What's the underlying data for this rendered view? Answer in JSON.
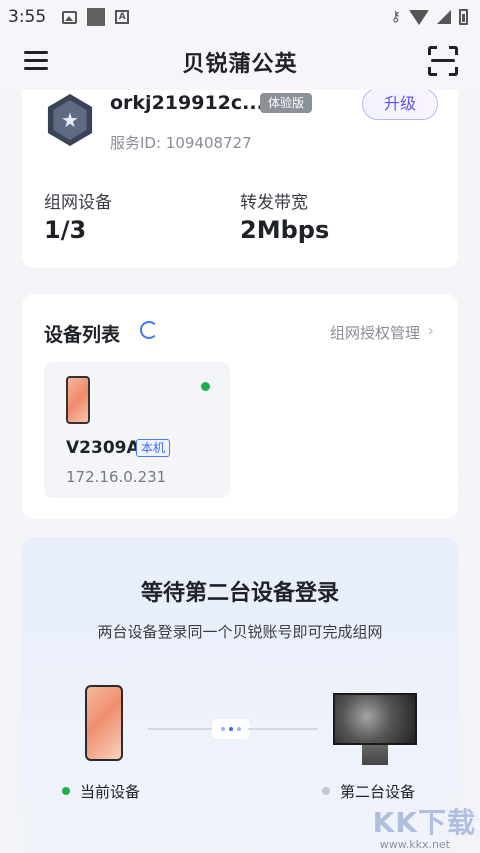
{
  "status_bar": {
    "time": "3:55"
  },
  "app_bar": {
    "title": "贝锐蒲公英",
    "menu_icon": "menu-icon",
    "scan_icon": "scan-icon"
  },
  "account": {
    "name": "orkj219912c...",
    "tag": "体验版",
    "upgrade_label": "升级",
    "service_id": "服务ID:  109408727",
    "badge_icon": "star-badge-icon"
  },
  "stats": [
    {
      "label": "组网设备",
      "value": "1/3"
    },
    {
      "label": "转发带宽",
      "value": "2Mbps"
    }
  ],
  "device_list": {
    "title": "设备列表",
    "auth_link": "组网授权管理",
    "devices": [
      {
        "name": "V2309A",
        "tag": "本机",
        "ip": "172.16.0.231",
        "online": true
      }
    ]
  },
  "pairing": {
    "title": "等待第二台设备登录",
    "subtitle": "两台设备登录同一个贝锐账号即可完成组网",
    "current_label": "当前设备",
    "second_label": "第二台设备",
    "current_dot_color": "#19b34a",
    "second_dot_color": "#c4c8d0"
  },
  "watermark": {
    "logo": "KK下载",
    "url": "www.kkx.net"
  },
  "colors": {
    "accent": "#3d6fe8",
    "upgrade": "#5b56e8",
    "online": "#19b34a"
  }
}
